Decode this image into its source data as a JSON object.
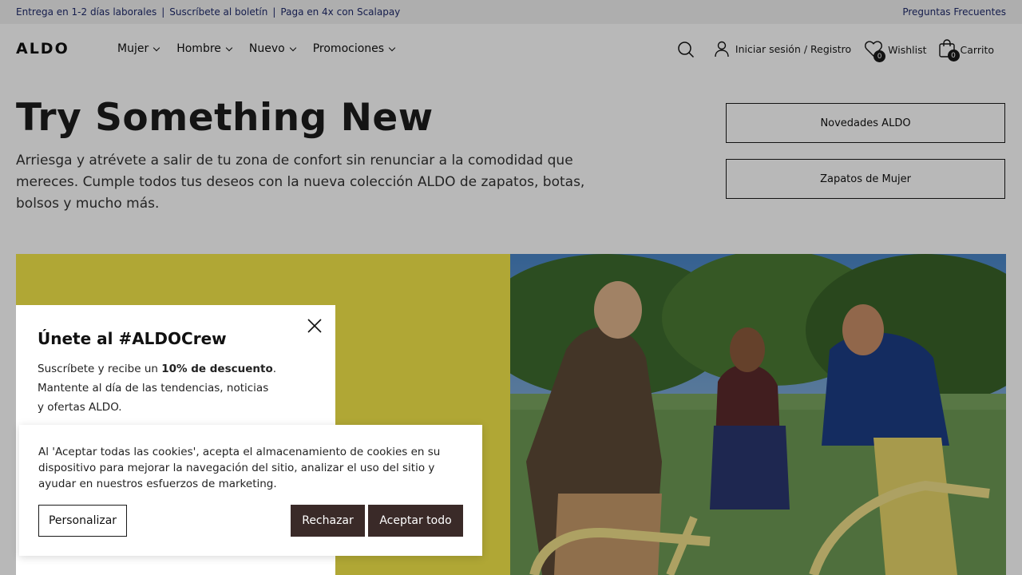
{
  "topbar": {
    "delivery": "Entrega en 1-2 días laborales",
    "newsletter": "Suscríbete al boletín",
    "pay": "Paga en 4x con Scalapay",
    "faq": "Preguntas Frecuentes"
  },
  "header": {
    "logo": "ALDO",
    "nav": [
      "Mujer",
      "Hombre",
      "Nuevo",
      "Promociones"
    ],
    "account": "Iniciar sesión / Registro",
    "wishlist_label": "Wishlist",
    "wishlist_count": "0",
    "cart_label": "Carrito",
    "cart_count": "0"
  },
  "hero": {
    "title": "Try Something New",
    "description": "Arriesga y atrévete a salir de tu zona de confort sin renunciar a la comodidad que mereces. Cumple todos tus deseos con la nueva colección ALDO de zapatos, botas, bolsos y mucho más.",
    "cta_new": "Novedades ALDO",
    "cta_women": "Zapatos de Mujer"
  },
  "popup": {
    "title": "Únete al #ALDOCrew",
    "text_before": "Suscríbete y recibe un ",
    "text_bold": "10% de descuento",
    "text_after": ". Mantente al día de las tendencias, noticias y ofertas ALDO."
  },
  "cookie": {
    "text": "Al 'Aceptar todas las cookies', acepta el almacenamiento de cookies en su dispositivo para mejorar la navegación del sitio, analizar el uso del sitio y ayudar en nuestros esfuerzos de marketing.",
    "customize": "Personalizar",
    "reject": "Rechazar",
    "accept": "Aceptar todo"
  },
  "colors": {
    "banner_yellow": "#f4e84a",
    "button_dark": "#3a2a28",
    "topbar_text": "#1f2a6b"
  }
}
